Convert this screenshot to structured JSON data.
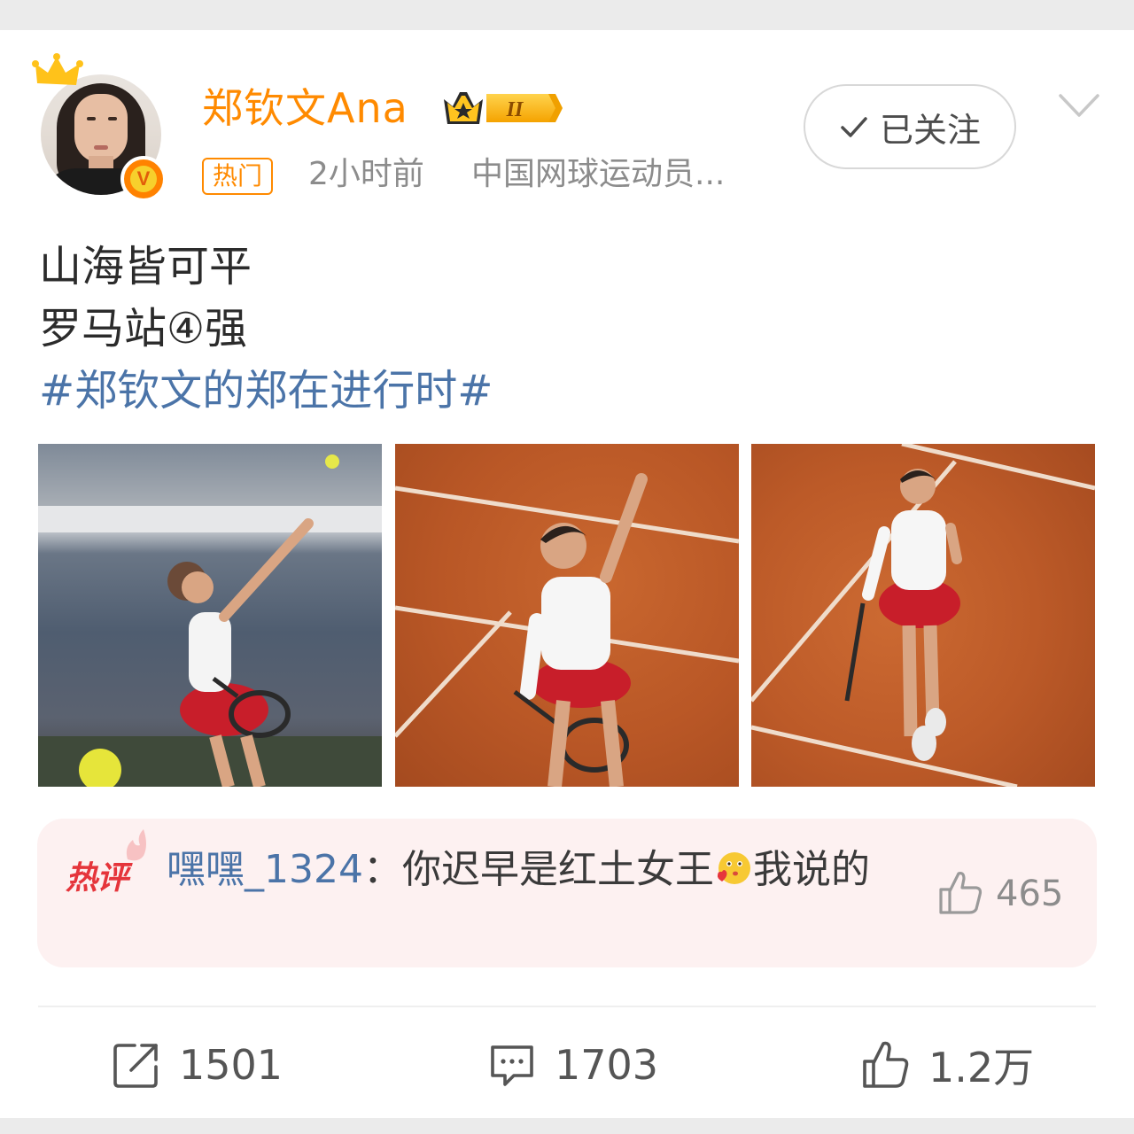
{
  "user": {
    "name": "郑钦文Ana",
    "tag": "热门",
    "time": "2小时前",
    "description": "中国网球运动员...",
    "follow_label": "已关注",
    "verified_mark": "V",
    "rank_mark": "II"
  },
  "post": {
    "lines": [
      "山海皆可平",
      "罗马站④强"
    ],
    "hashtag": "#郑钦文的郑在进行时#"
  },
  "hot_comment": {
    "label": "热评",
    "user": "嘿嘿_1324",
    "separator": "：",
    "text_before": "你迟早是红土女王",
    "text_after": "我说的",
    "emoji": "kiss-heart-emoji",
    "likes": "465"
  },
  "actions": {
    "share_count": "1501",
    "comment_count": "1703",
    "like_count": "1.2万"
  },
  "colors": {
    "brand_orange": "#ff8a00",
    "hashtag_blue": "#4b74a8",
    "hot_red": "#e5353b"
  }
}
